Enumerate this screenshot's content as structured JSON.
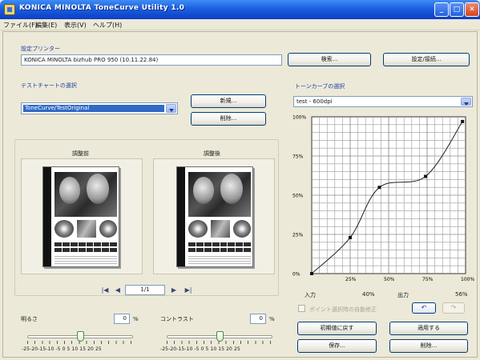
{
  "window": {
    "title": "KONICA MINOLTA ToneCurve Utility 1.0",
    "min": "_",
    "max": "□",
    "close": "✕"
  },
  "menu": [
    "ファイル(F)",
    "編集(E)",
    "表示(V)",
    "ヘルプ(H)"
  ],
  "printer": {
    "label": "設定プリンター",
    "value": "KONICA MINOLTA bizhub PRO 950 (10.11.22.84)",
    "search_button": "検索...",
    "settings_button": "設定/接続..."
  },
  "tone_file": {
    "label": "テストチャートの選択",
    "selected": "ToneCurve/TestOriginal",
    "new_button": "新規...",
    "delete_button": "削除..."
  },
  "preview": {
    "before_label": "調整前",
    "after_label": "調整後",
    "page_indicator": "1/1",
    "nav_first": "|◀",
    "nav_prev": "◀",
    "nav_next": "▶",
    "nav_last": "▶|"
  },
  "brightness": {
    "label": "明るさ",
    "value": "0",
    "unit": "%",
    "fraction": 0.5,
    "scale": "-25-20-15-10 -5  0  5  10 15 20 25"
  },
  "contrast": {
    "label": "コントラスト",
    "value": "0",
    "unit": "%",
    "fraction": 0.5,
    "scale": "-25-20-15-10 -5  0  5  10 15 20 25"
  },
  "curve": {
    "label": "トーンカーブの選択",
    "selected": "test - 600dpi",
    "y_ticks": [
      "100%",
      "75%",
      "50%",
      "25%",
      "0%"
    ],
    "x_ticks": [
      "25%",
      "50%",
      "75%",
      "100%"
    ],
    "input_label": "入力",
    "input_value": "40%",
    "output_label": "出力",
    "output_value": "56%",
    "checkbox_label": "ポイント選択時の自動修正",
    "undo": "↶",
    "redo": "↷"
  },
  "buttons": {
    "reset": "初期値に戻す",
    "apply": "適用する",
    "save": "保存...",
    "remove": "削除..."
  },
  "colors": {
    "title_bar": "#1d5fe0",
    "label_blue": "#1e3fa0",
    "selection": "#316ac5"
  },
  "chart_data": {
    "type": "line",
    "x": [
      0,
      25,
      44,
      74,
      98
    ],
    "y": [
      0,
      23,
      55,
      62,
      97
    ],
    "xlim": [
      0,
      100
    ],
    "ylim": [
      0,
      100
    ]
  }
}
